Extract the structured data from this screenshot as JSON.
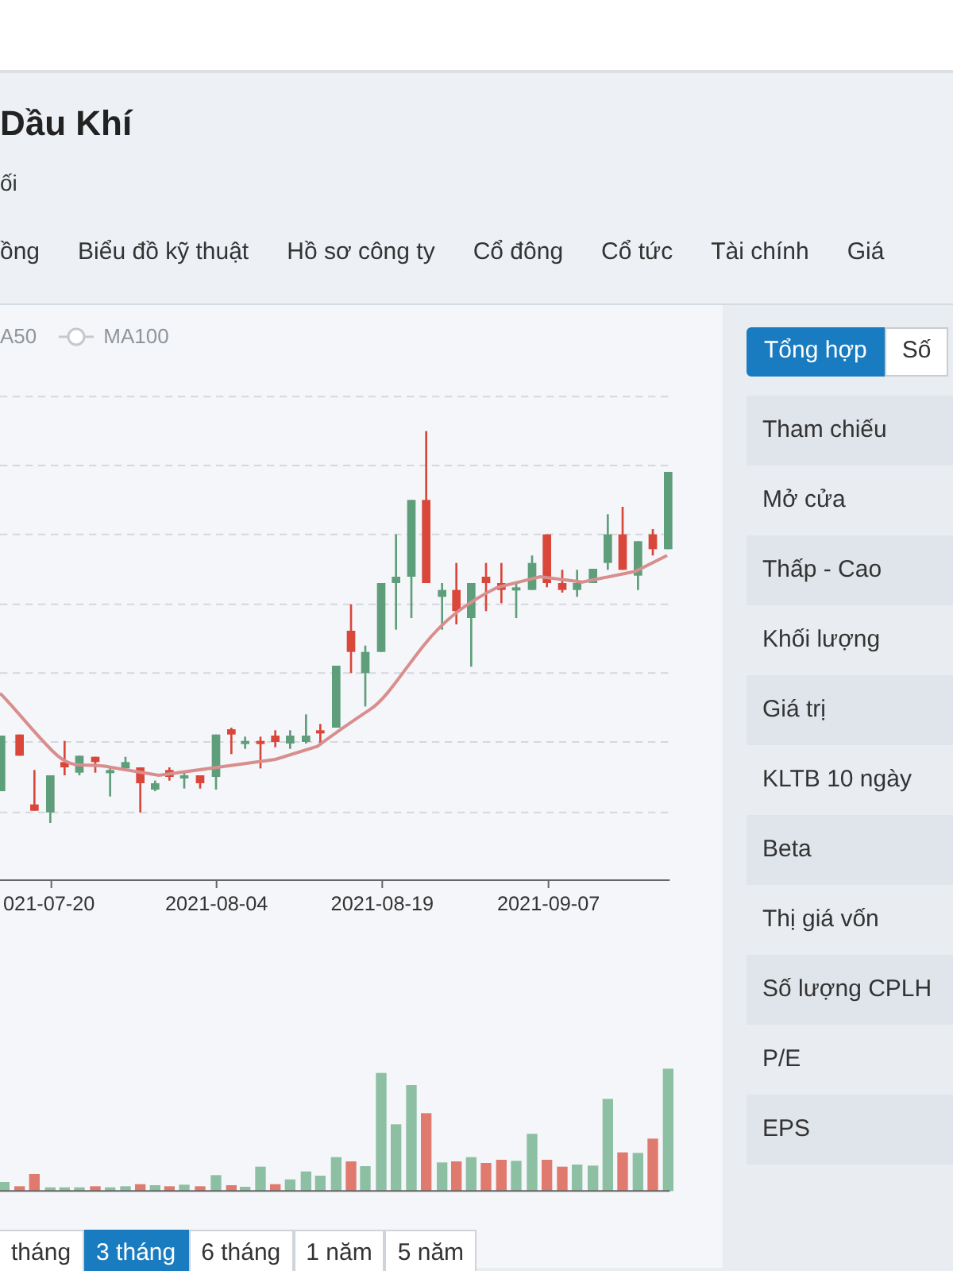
{
  "header": {
    "title": "Dầu Khí",
    "subtitle": "ối"
  },
  "nav_tabs": [
    {
      "label": "ồng"
    },
    {
      "label": "Biểu đồ kỹ thuật"
    },
    {
      "label": "Hồ sơ công ty"
    },
    {
      "label": "Cổ đông"
    },
    {
      "label": "Cổ tức"
    },
    {
      "label": "Tài chính"
    },
    {
      "label": "Giá"
    }
  ],
  "chart": {
    "legend": [
      {
        "label": "A50",
        "marker_shown": false
      },
      {
        "label": "MA100",
        "marker_shown": true
      }
    ],
    "x_labels": [
      "021-07-20",
      "2021-08-04",
      "2021-08-19",
      "2021-09-07"
    ]
  },
  "range_buttons": [
    {
      "label": "tháng",
      "selected": false
    },
    {
      "label": "3 tháng",
      "selected": true
    },
    {
      "label": "6 tháng",
      "selected": false
    },
    {
      "label": "1 năm",
      "selected": false
    },
    {
      "label": "5 năm",
      "selected": false
    }
  ],
  "summary": {
    "tabs": [
      {
        "label": "Tổng hợp",
        "selected": true
      },
      {
        "label": "Số",
        "selected": false
      }
    ],
    "rows": [
      "Tham chiếu",
      "Mở cửa",
      "Thấp - Cao",
      "Khối lượng",
      "Giá trị",
      "KLTB 10 ngày",
      "Beta",
      "Thị giá vốn",
      "Số lượng CPLH",
      "P/E",
      "EPS"
    ]
  }
}
